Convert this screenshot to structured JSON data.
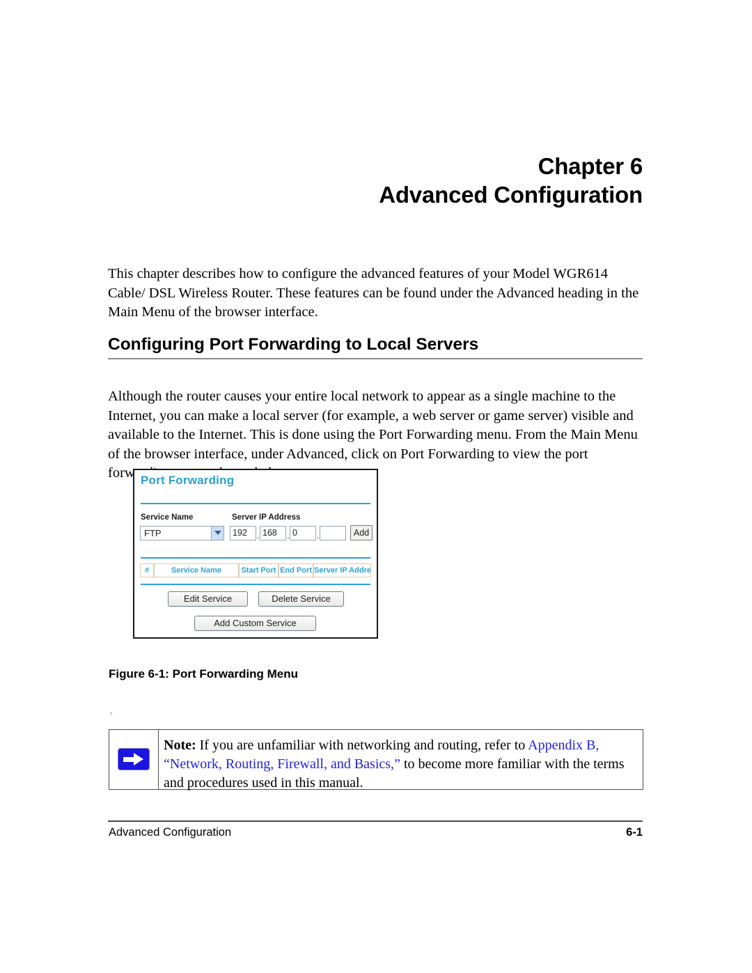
{
  "chapter": {
    "number_line": "Chapter 6",
    "title_line": "Advanced Configuration"
  },
  "intro_paragraph": "This chapter describes how to configure the advanced features of your Model WGR614 Cable/ DSL Wireless Router. These features can be found under the Advanced heading in the Main Menu of the browser interface.",
  "section": {
    "heading": "Configuring Port Forwarding to Local Servers",
    "paragraph": "Although the router causes your entire local network to appear as a single machine to the Internet, you can make a local server (for example, a web server or game server) visible and available to the Internet. This is done using the Port Forwarding menu. From the Main Menu of the browser interface, under Advanced, click on Port Forwarding to view the port forwarding menu, shown below."
  },
  "figure": {
    "caption": "Figure 6-1:  Port Forwarding Menu",
    "screenshot": {
      "title": "Port Forwarding",
      "title_color": "#2a9fd0",
      "labels": {
        "service_name": "Service Name",
        "server_ip_address": "Server IP Address"
      },
      "service_select": {
        "value": "FTP",
        "icon": "chevron-down-icon"
      },
      "ip_octets": [
        "192",
        "168",
        "0",
        ""
      ],
      "ip_separator": ".",
      "add_button": "Add",
      "table_headers": [
        "#",
        "Service Name",
        "Start Port",
        "End Port",
        "Server IP Address"
      ],
      "table_rows": [],
      "buttons": {
        "edit_service": "Edit Service",
        "delete_service": "Delete Service",
        "add_custom_service": "Add Custom Service"
      }
    }
  },
  "note": {
    "icon": "blue-arrow-icon",
    "label": "Note:",
    "text_before_link": " If you are unfamiliar with networking and routing, refer to ",
    "link_1": "Appendix B,",
    "link_2": "“Network, Routing, Firewall, and Basics,”",
    "text_after_link": " to become more familiar with the terms and procedures used in this manual.",
    "link_color": "#2222dd"
  },
  "footer": {
    "left": "Advanced Configuration",
    "right": "6-1"
  }
}
